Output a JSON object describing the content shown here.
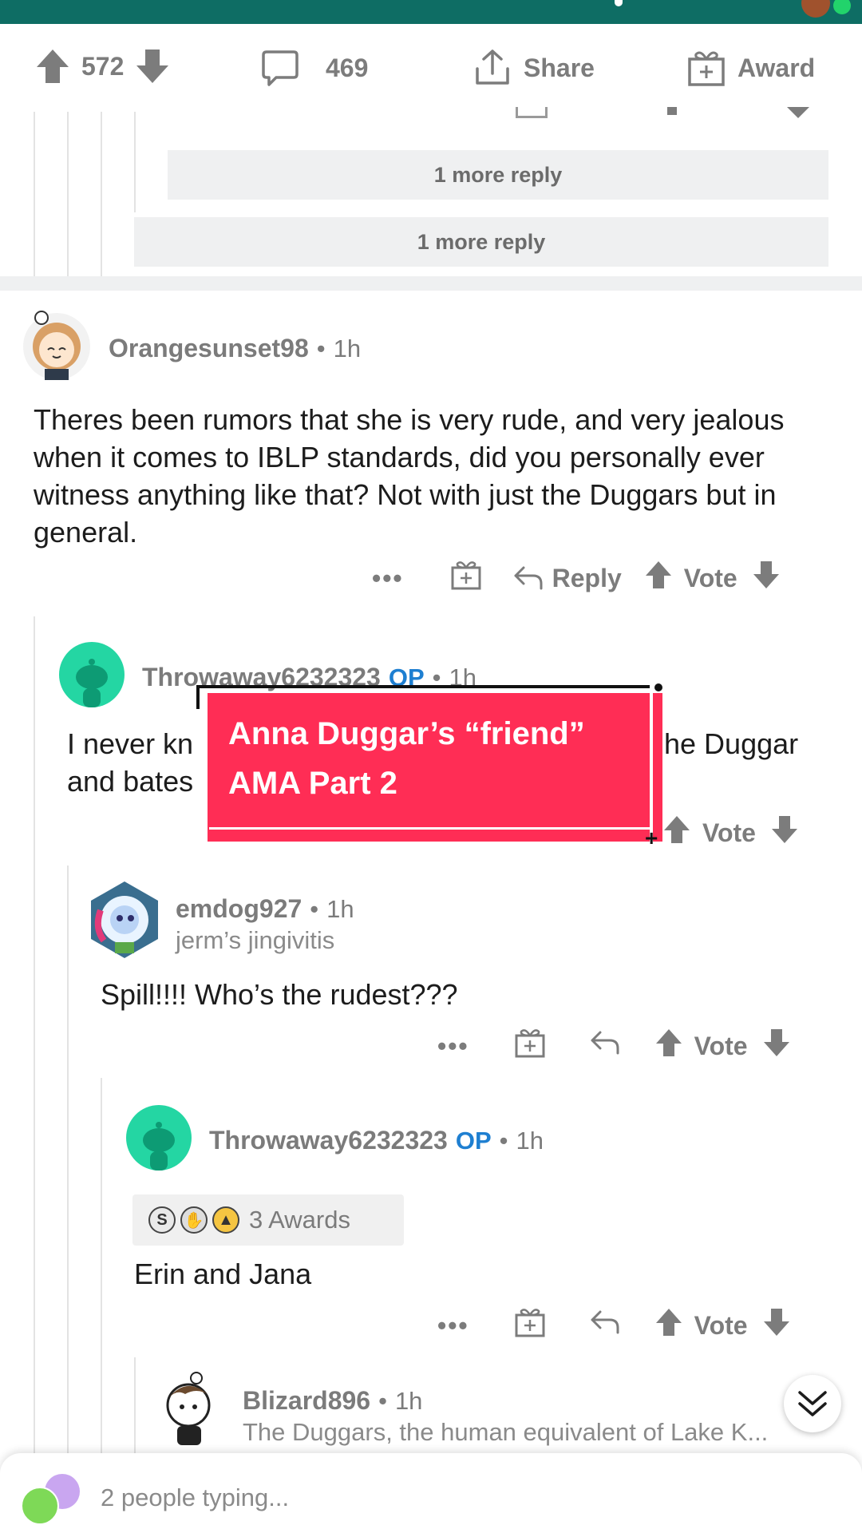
{
  "post_actions": {
    "vote_count": "572",
    "comment_count": "469",
    "share_label": "Share",
    "award_label": "Award"
  },
  "collapsed": {
    "more_reply_1": "1 more reply",
    "more_reply_2": "1 more reply"
  },
  "comments": [
    {
      "username": "Orangesunset98",
      "time": "1h",
      "body": "Theres been rumors that she is very rude, and very jealous when it comes to IBLP standards, did you personally ever witness anything like that? Not with just the Duggars but in general.",
      "reply_label": "Reply",
      "vote_label": "Vote"
    },
    {
      "username": "Throwaway6232323",
      "op_badge": "OP",
      "time": "1h",
      "body_line1_start": "I never kn",
      "body_line1_end": "he Duggar",
      "body_line2_start": "and bates",
      "vote_label": "Vote"
    },
    {
      "username": "emdog927",
      "time": "1h",
      "flair": "jerm’s jingivitis",
      "body": "Spill!!!! Who’s the rudest???",
      "vote_label": "Vote"
    },
    {
      "username": "Throwaway6232323",
      "op_badge": "OP",
      "time": "1h",
      "awards_label": "3 Awards",
      "body": "Erin and Jana",
      "vote_label": "Vote"
    },
    {
      "username": "Blizard896",
      "time": "1h",
      "flair": "The Duggars, the human equivalent of Lake K..."
    }
  ],
  "overlay": {
    "line1": "Anna Duggar’s “friend”",
    "line2": "AMA Part 2"
  },
  "typing_indicator": "2 people typing...",
  "colors": {
    "top_bar": "#0e6d64",
    "op_badge": "#1e7fd1",
    "overlay_bg": "#ff2d55",
    "snoo_avatar": "#24d6a3"
  }
}
